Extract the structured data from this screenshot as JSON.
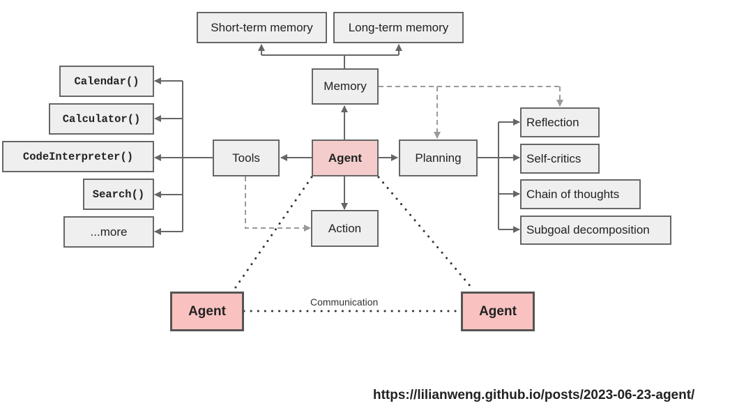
{
  "diagram": {
    "center": {
      "label": "Agent"
    },
    "memory": {
      "label": "Memory",
      "children": [
        "Short-term memory",
        "Long-term memory"
      ]
    },
    "tools": {
      "label": "Tools",
      "children": [
        "Calendar()",
        "Calculator()",
        "CodeInterpreter()",
        "Search()",
        "...more"
      ]
    },
    "planning": {
      "label": "Planning",
      "children": [
        "Reflection",
        "Self-critics",
        "Chain of thoughts",
        "Subgoal decomposition"
      ]
    },
    "action": {
      "label": "Action"
    },
    "peers": [
      {
        "label": "Agent"
      },
      {
        "label": "Agent"
      }
    ],
    "communication_label": "Communication",
    "source_url": "https://lilianweng.github.io/posts/2023-06-23-agent/",
    "colors": {
      "node_fill": "#efefef",
      "agent_fill": "#f4cccc",
      "peer_agent_fill": "#f9c2c0",
      "stroke": "#666666",
      "dashed": "#999999",
      "dotted": "#333333"
    }
  }
}
